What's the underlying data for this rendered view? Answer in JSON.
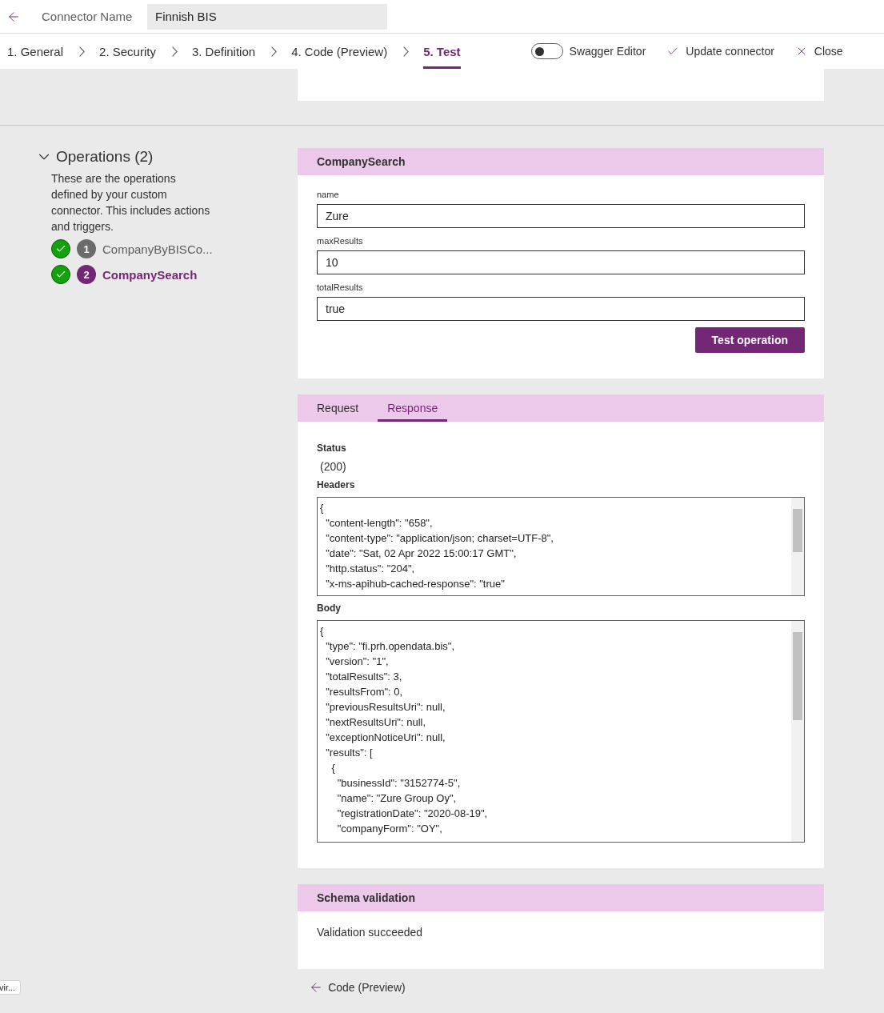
{
  "header": {
    "name_label": "Connector Name",
    "name_value": "Finnish BIS"
  },
  "steps": [
    {
      "label": "1. General",
      "selected": false
    },
    {
      "label": "2. Security",
      "selected": false
    },
    {
      "label": "3. Definition",
      "selected": false
    },
    {
      "label": "4. Code (Preview)",
      "selected": false
    },
    {
      "label": "5. Test",
      "selected": true
    }
  ],
  "actions": {
    "swagger_editor": {
      "label": "Swagger Editor",
      "on": false
    },
    "update": "Update connector",
    "close": "Close"
  },
  "operations": {
    "title": "Operations (2)",
    "expanded": true,
    "description": "These are the operations defined by your custom connector. This includes actions and triggers.",
    "items": [
      {
        "number": "1",
        "name": "CompanyByBISCo...",
        "validated": true,
        "selected": false
      },
      {
        "number": "2",
        "name": "CompanySearch",
        "validated": true,
        "selected": true
      }
    ]
  },
  "operation_card": {
    "title": "CompanySearch",
    "fields": [
      {
        "label": "name",
        "value": "Zure"
      },
      {
        "label": "maxResults",
        "value": "10"
      },
      {
        "label": "totalResults",
        "value": "true"
      }
    ],
    "button": "Test operation"
  },
  "response_card": {
    "tabs": [
      {
        "label": "Request",
        "selected": false
      },
      {
        "label": "Response",
        "selected": true
      }
    ],
    "status_label": "Status",
    "status": "(200)",
    "headers_label": "Headers",
    "headers_lines": [
      "{",
      "  \"content-length\": \"658\",",
      "  \"content-type\": \"application/json; charset=UTF-8\",",
      "  \"date\": \"Sat, 02 Apr 2022 15:00:17 GMT\",",
      "  \"http.status\": \"204\",",
      "  \"x-ms-apihub-cached-response\": \"true\""
    ],
    "body_label": "Body",
    "body_lines": [
      "{",
      "  \"type\": \"fi.prh.opendata.bis\",",
      "  \"version\": \"1\",",
      "  \"totalResults\": 3,",
      "  \"resultsFrom\": 0,",
      "  \"previousResultsUri\": null,",
      "  \"nextResultsUri\": null,",
      "  \"exceptionNoticeUri\": null,",
      "  \"results\": [",
      "    {",
      "      \"businessId\": \"3152774-5\",",
      "      \"name\": \"Zure Group Oy\",",
      "      \"registrationDate\": \"2020-08-19\",",
      "      \"companyForm\": \"OY\","
    ]
  },
  "schema": {
    "title": "Schema validation",
    "message": "Validation succeeded"
  },
  "footer": {
    "chip": "vir...",
    "previous_step": "Code (Preview)"
  }
}
